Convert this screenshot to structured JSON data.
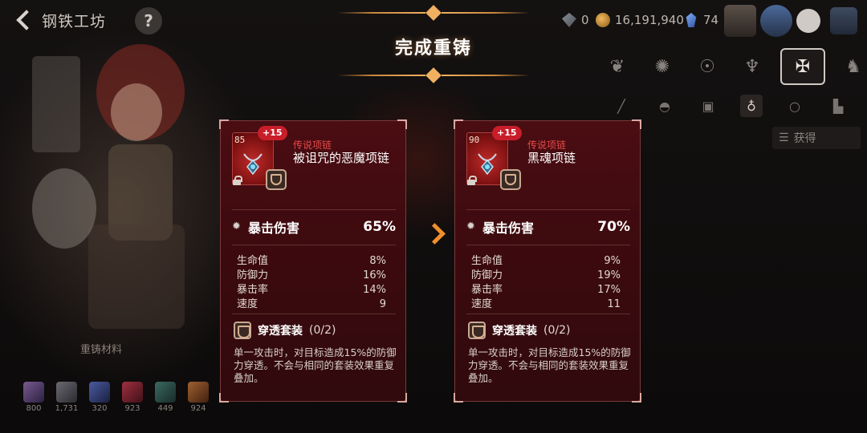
{
  "header": {
    "page_title": "钢铁工坊",
    "help_label": "?",
    "resources": [
      {
        "icon": "gem-icon",
        "value": "0"
      },
      {
        "icon": "gold-coin-icon",
        "value": "16,191,940"
      },
      {
        "icon": "crystal-icon",
        "value": "74"
      }
    ]
  },
  "banner": {
    "title": "完成重铸"
  },
  "side_panel": {
    "filter_label": "获得",
    "materials_title": "重铸材料",
    "materials": [
      {
        "icon": "material-1-icon",
        "count": "800"
      },
      {
        "icon": "material-2-icon",
        "count": "1,731"
      },
      {
        "icon": "material-3-icon",
        "count": "320"
      },
      {
        "icon": "material-4-icon",
        "count": "923"
      },
      {
        "icon": "material-5-icon",
        "count": "449"
      },
      {
        "icon": "material-6-icon",
        "count": "924"
      }
    ]
  },
  "before": {
    "level": "85",
    "enhance": "+15",
    "rarity": "传说项链",
    "name": "被诅咒的恶魔项链",
    "main_stat": {
      "name": "暴击伤害",
      "value": "65%"
    },
    "sub_stats": [
      {
        "name": "生命值",
        "value": "8%"
      },
      {
        "name": "防御力",
        "value": "16%"
      },
      {
        "name": "暴击率",
        "value": "14%"
      },
      {
        "name": "速度",
        "value": "9"
      }
    ],
    "set_name": "穿透套装",
    "set_count": "(0/2)",
    "set_desc": "单一攻击时，对目标造成15%的防御力穿透。不会与相同的套装效果重复叠加。"
  },
  "after": {
    "level": "90",
    "enhance": "+15",
    "rarity": "传说项链",
    "name": "黑魂项链",
    "main_stat": {
      "name": "暴击伤害",
      "value": "70%"
    },
    "sub_stats": [
      {
        "name": "生命值",
        "value": "9%"
      },
      {
        "name": "防御力",
        "value": "19%"
      },
      {
        "name": "暴击率",
        "value": "17%"
      },
      {
        "name": "速度",
        "value": "11"
      }
    ],
    "set_name": "穿透套装",
    "set_count": "(0/2)",
    "set_desc": "单一攻击时，对目标造成15%的防御力穿透。不会与相同的套装效果重复叠加。"
  }
}
